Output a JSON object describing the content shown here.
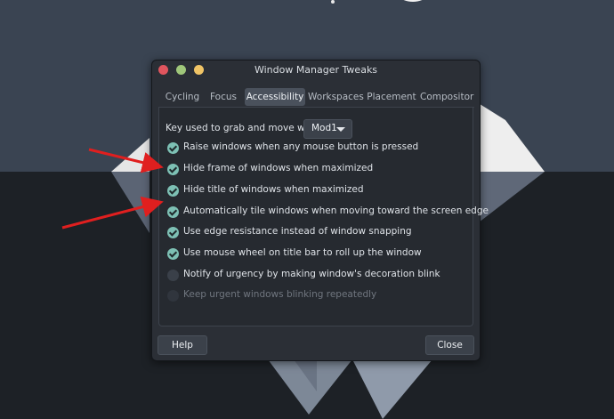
{
  "window": {
    "title": "Window Manager Tweaks"
  },
  "tabs": [
    {
      "label": "Cycling",
      "active": false
    },
    {
      "label": "Focus",
      "active": false
    },
    {
      "label": "Accessibility",
      "active": true
    },
    {
      "label": "Workspaces",
      "active": false
    },
    {
      "label": "Placement",
      "active": false
    },
    {
      "label": "Compositor",
      "active": false
    }
  ],
  "accessibility": {
    "key_label": "Key used to grab and move windows:",
    "key_value": "Mod1",
    "options": [
      {
        "label": "Raise windows when any mouse button is pressed",
        "checked": true,
        "enabled": true
      },
      {
        "label": "Hide frame of windows when maximized",
        "checked": true,
        "enabled": true
      },
      {
        "label": "Hide title of windows when maximized",
        "checked": true,
        "enabled": true
      },
      {
        "label": "Automatically tile windows when moving toward the screen edge",
        "checked": true,
        "enabled": true
      },
      {
        "label": "Use edge resistance instead of window snapping",
        "checked": true,
        "enabled": true
      },
      {
        "label": "Use mouse wheel on title bar to roll up the window",
        "checked": true,
        "enabled": true
      },
      {
        "label": "Notify of urgency by making window's decoration blink",
        "checked": false,
        "enabled": true
      },
      {
        "label": "Keep urgent windows blinking repeatedly",
        "checked": false,
        "enabled": false
      }
    ]
  },
  "buttons": {
    "help": "Help",
    "close": "Close"
  },
  "colors": {
    "accent_check": "#7dc0b4",
    "annotation_arrow": "#e01f1f"
  },
  "icons": {
    "checkbox": "check-circle-icon",
    "dropdown": "chevron-down-icon"
  }
}
